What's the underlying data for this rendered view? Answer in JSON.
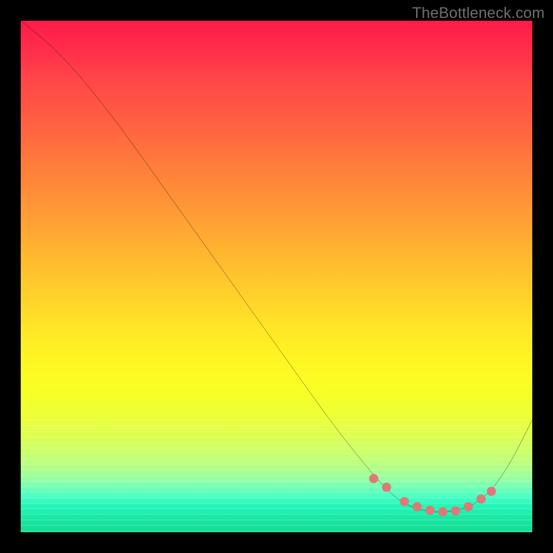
{
  "watermark": "TheBottleneck.com",
  "chart_data": {
    "type": "line",
    "title": "",
    "xlabel": "",
    "ylabel": "",
    "xlim": [
      0,
      100
    ],
    "ylim": [
      0,
      100
    ],
    "grid": false,
    "series": [
      {
        "name": "bottleneck-curve",
        "x": [
          0,
          5,
          10,
          15,
          20,
          25,
          30,
          35,
          40,
          45,
          50,
          55,
          60,
          65,
          70,
          73,
          76,
          80,
          84,
          88,
          92,
          96,
          100
        ],
        "y": [
          100,
          96,
          91,
          85,
          78.5,
          71.5,
          64.5,
          57.5,
          50.5,
          43.5,
          36.5,
          29.5,
          22.5,
          16,
          10,
          7,
          5,
          4,
          4,
          5,
          8,
          14,
          22
        ],
        "color": "#000000",
        "markers": false
      },
      {
        "name": "marker-points",
        "x": [
          69,
          71.5,
          75,
          77.5,
          80,
          82.5,
          85,
          87.5,
          90,
          92
        ],
        "y": [
          10.5,
          8.8,
          6,
          5,
          4.3,
          4,
          4.2,
          5,
          6.5,
          8
        ],
        "color": "#e07878",
        "markers": true
      }
    ],
    "annotations": []
  },
  "colors": {
    "curve": "#000000",
    "marker": "#e07878",
    "background_top": "#ff1a4a",
    "background_bottom": "#14db90",
    "frame": "#000000"
  }
}
